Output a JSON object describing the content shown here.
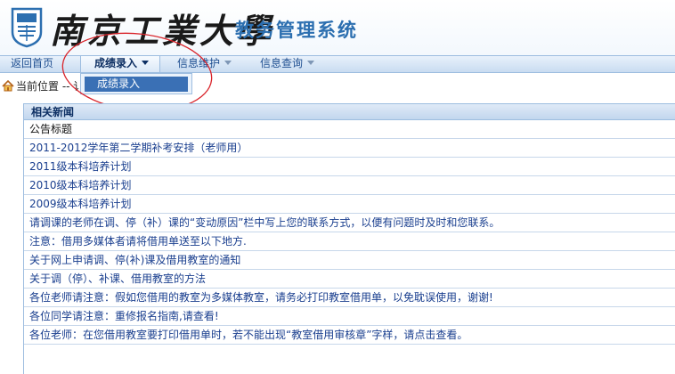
{
  "header": {
    "university_name": "南京工業大學",
    "system_name": "教务管理系统"
  },
  "nav": {
    "items": [
      {
        "label": "返回首页"
      },
      {
        "label": "成绩录入"
      },
      {
        "label": "信息维护"
      },
      {
        "label": "信息查询"
      }
    ],
    "dropdown": {
      "items": [
        {
          "label": "成绩录入"
        }
      ]
    }
  },
  "breadcrumb": {
    "text": "当前位置 -- 讠"
  },
  "news": {
    "title": "相关新闻",
    "column_header": "公告标题",
    "items": [
      {
        "title": "2011-2012学年第二学期补考安排（老师用）"
      },
      {
        "title": "2011级本科培养计划"
      },
      {
        "title": "2010级本科培养计划"
      },
      {
        "title": "2009级本科培养计划"
      },
      {
        "title": "请调课的老师在调、停（补）课的“变动原因”栏中写上您的联系方式，以便有问题时及时和您联系。"
      },
      {
        "title": "注意：借用多媒体者请将借用单送至以下地方."
      },
      {
        "title": "关于网上申请调、停(补)课及借用教室的通知"
      },
      {
        "title": "关于调（停）、补课、借用教室的方法"
      },
      {
        "title": "各位老师请注意：假如您借用的教室为多媒体教室，请务必打印教室借用单，以免耽误使用，谢谢!"
      },
      {
        "title": "各位同学请注意：重修报名指南,请查看!"
      },
      {
        "title": "各位老师：在您借用教室要打印借用单时，若不能出现“教室借用审核章”字样，请点击查看。"
      }
    ]
  },
  "colors": {
    "accent": "#2c6fb0",
    "nav_background": "#c9dcf1",
    "dropdown_selected": "#3a70b5",
    "annotation": "#d9232a"
  }
}
